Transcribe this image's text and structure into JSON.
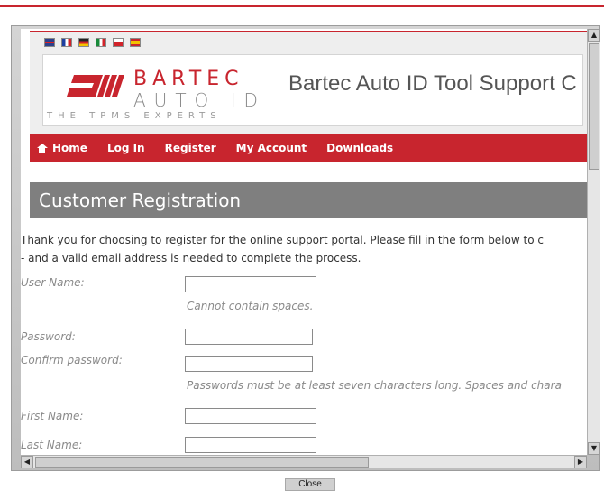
{
  "header": {
    "flags": [
      "gb-flag-icon",
      "fr-flag-icon",
      "de-flag-icon",
      "it-flag-icon",
      "pl-flag-icon",
      "es-flag-icon"
    ],
    "brand_top": "BARTEC",
    "brand_bottom": "AUTO ID",
    "tagline": "THE TPMS EXPERTS",
    "site_title": "Bartec Auto ID Tool Support C"
  },
  "nav": {
    "items": [
      "Home",
      "Log In",
      "Register",
      "My Account",
      "Downloads"
    ]
  },
  "page": {
    "section_title": "Customer Registration",
    "intro_line1": "Thank you for choosing to register for the online support portal. Please fill in the form below to c",
    "intro_line2": "- and a valid email address is needed to complete the process."
  },
  "form": {
    "username_label": "User Name:",
    "username_hint": "Cannot contain spaces.",
    "password_label": "Password:",
    "confirm_label": "Confirm password:",
    "password_hint": "Passwords must be at least seven characters long. Spaces and chara",
    "firstname_label": "First Name:",
    "lastname_label": "Last Name:",
    "username_value": "",
    "password_value": "",
    "confirm_value": "",
    "firstname_value": "",
    "lastname_value": ""
  },
  "footer": {
    "close_label": "Close"
  },
  "colors": {
    "brand_red": "#c8252e",
    "section_gray": "#7f7f7f"
  }
}
